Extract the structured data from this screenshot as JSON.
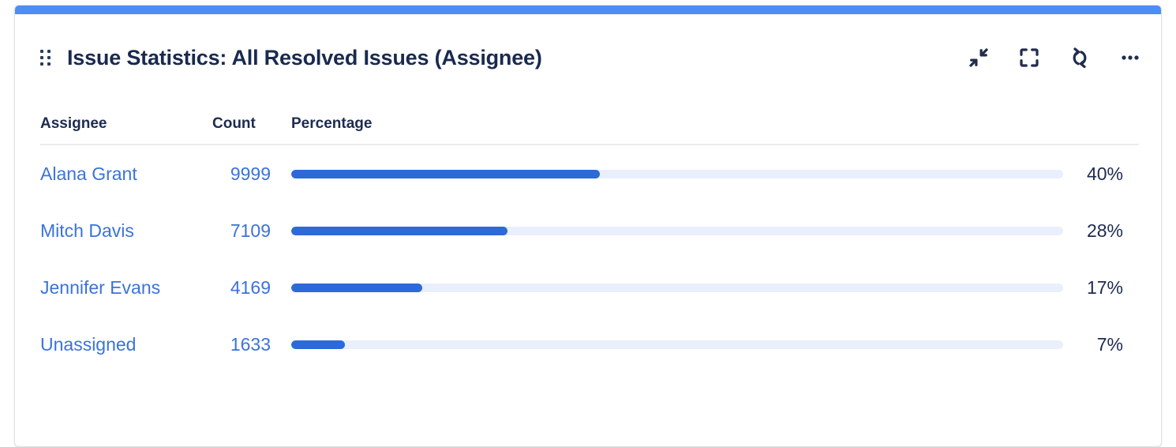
{
  "gadget": {
    "title": "Issue Statistics: All Resolved Issues (Assignee)",
    "accent_color": "#4c8df6",
    "drag_handle_icon": "drag-handle-icon",
    "actions": [
      {
        "name": "collapse-button",
        "icon": "collapse-arrows-icon",
        "label": "Collapse"
      },
      {
        "name": "fullscreen-button",
        "icon": "fullscreen-brackets-icon",
        "label": "Maximize"
      },
      {
        "name": "refresh-button",
        "icon": "refresh-icon",
        "label": "Refresh"
      },
      {
        "name": "more-options-button",
        "icon": "ellipsis-horizontal-icon",
        "label": "More"
      }
    ]
  },
  "table": {
    "columns": [
      "Assignee",
      "Count",
      "Percentage"
    ],
    "link_color": "#3b72dd",
    "bar_fill_color": "#2d6ad9",
    "bar_track_color": "#e9effb",
    "rows": [
      {
        "assignee": "Alana Grant",
        "count": "9999",
        "percentage": "40%",
        "pct_value": 40
      },
      {
        "assignee": "Mitch Davis",
        "count": "7109",
        "percentage": "28%",
        "pct_value": 28
      },
      {
        "assignee": "Jennifer Evans",
        "count": "4169",
        "percentage": "17%",
        "pct_value": 17
      },
      {
        "assignee": "Unassigned",
        "count": "1633",
        "percentage": "7%",
        "pct_value": 7
      }
    ]
  },
  "chart_data": {
    "type": "bar",
    "title": "Issue Statistics: All Resolved Issues (Assignee)",
    "categories": [
      "Alana Grant",
      "Mitch Davis",
      "Jennifer Evans",
      "Unassigned"
    ],
    "values": [
      9999,
      7109,
      4169,
      1633
    ],
    "percentages": [
      40,
      28,
      17,
      7
    ],
    "xlabel": "Assignee",
    "ylabel": "Count",
    "ylim": [
      0,
      100
    ],
    "grid": false,
    "legend": "none",
    "orientation": "horizontal"
  }
}
